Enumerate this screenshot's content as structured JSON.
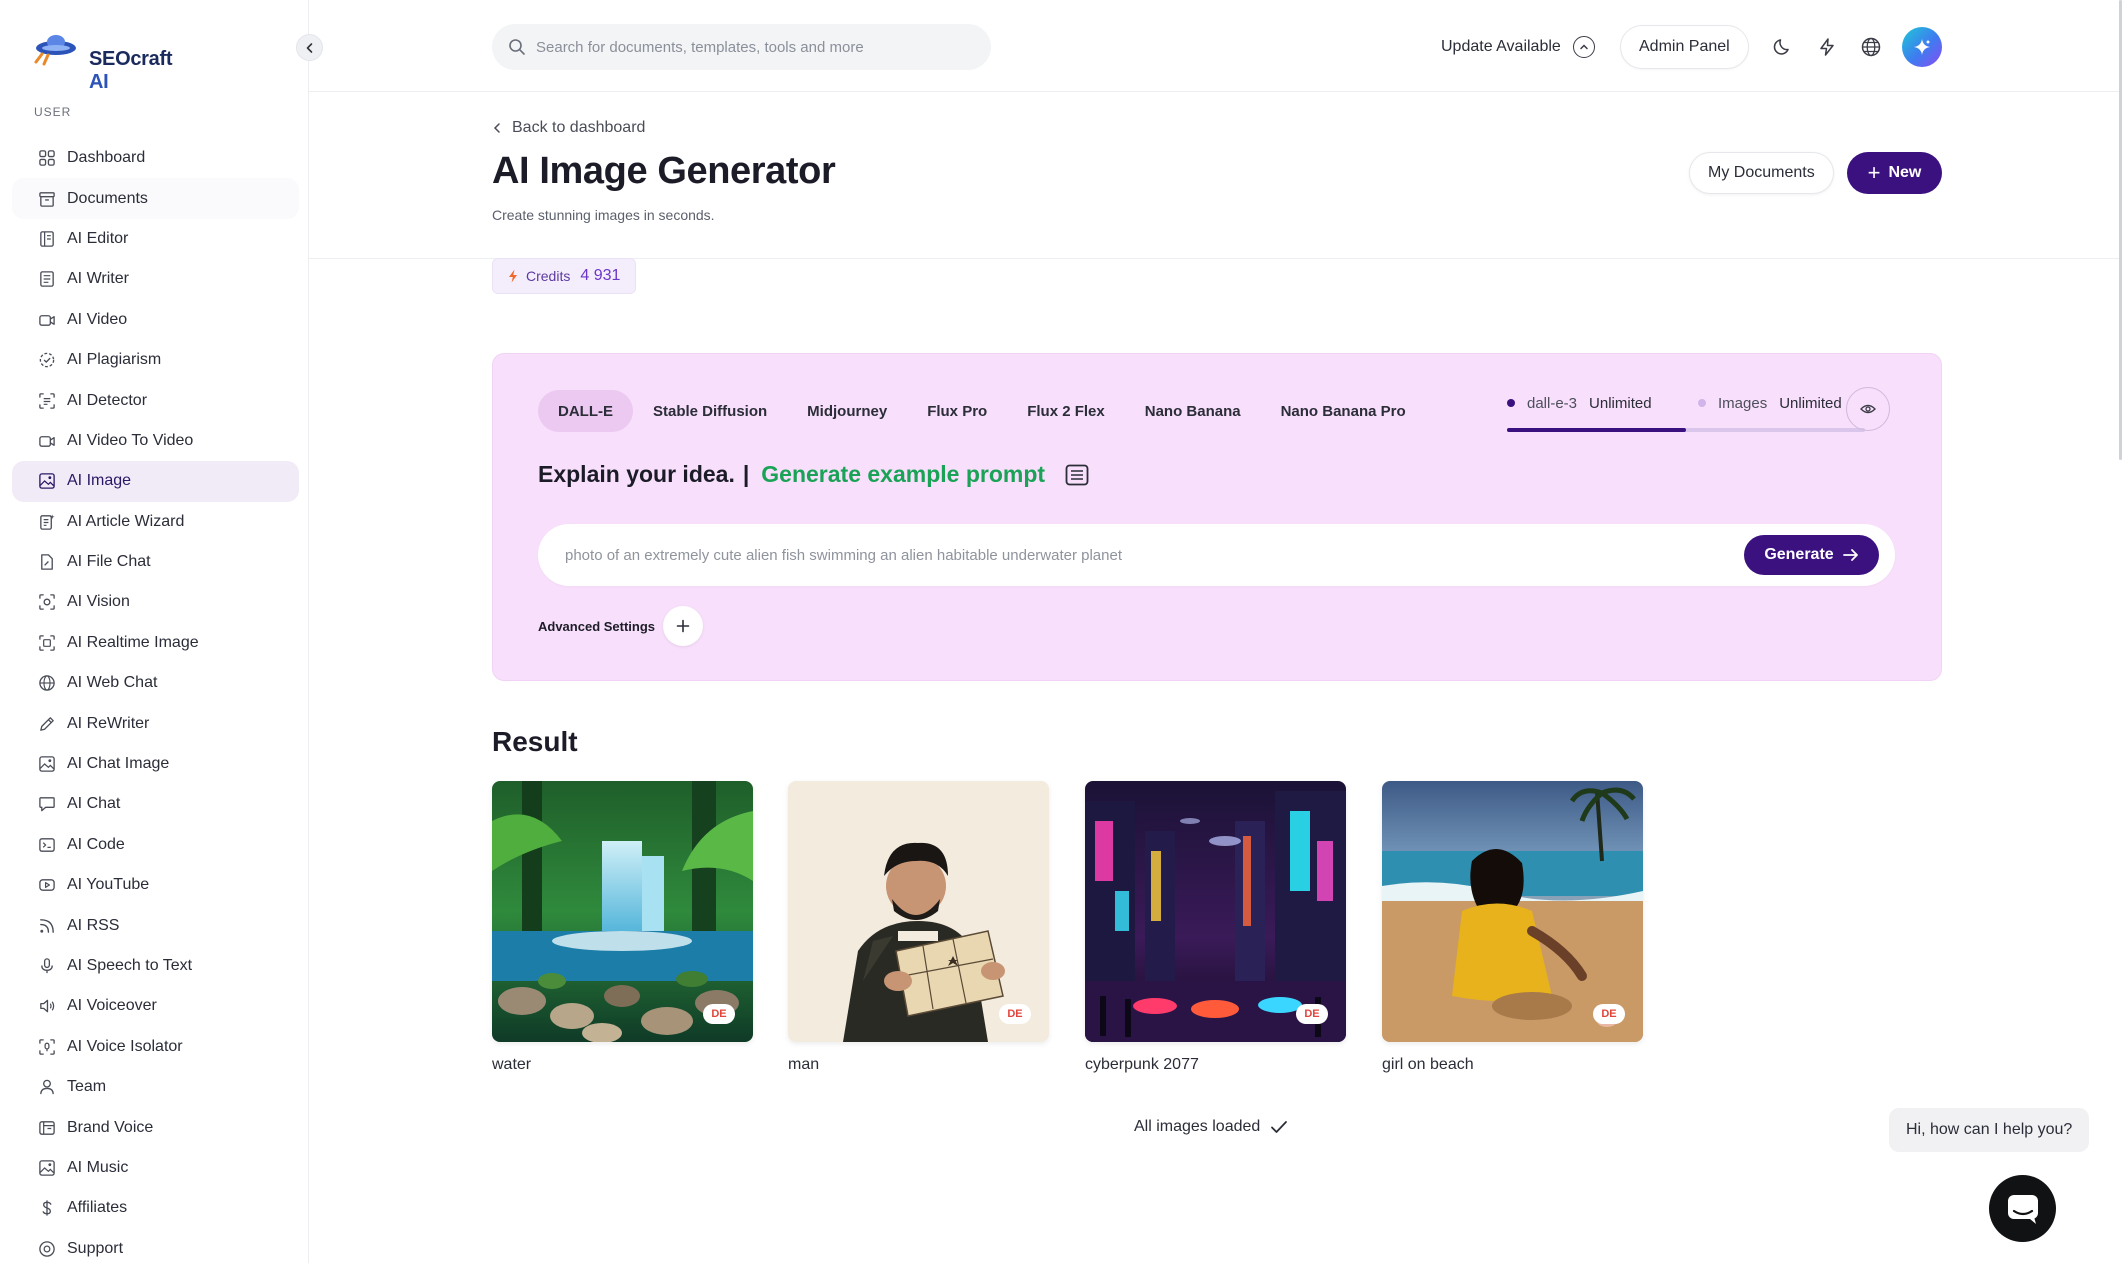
{
  "brand": {
    "name_part1": "SEOcraft",
    "name_part2": " AI"
  },
  "sidebar": {
    "section_label": "USER",
    "items": [
      {
        "label": "Dashboard",
        "icon": "grid-icon"
      },
      {
        "label": "Documents",
        "icon": "archive-icon"
      },
      {
        "label": "AI Editor",
        "icon": "editor-icon"
      },
      {
        "label": "AI Writer",
        "icon": "document-icon"
      },
      {
        "label": "AI Video",
        "icon": "video-icon"
      },
      {
        "label": "AI Plagiarism",
        "icon": "dashed-check-icon"
      },
      {
        "label": "AI Detector",
        "icon": "scan-icon"
      },
      {
        "label": "AI Video To Video",
        "icon": "video-icon"
      },
      {
        "label": "AI Image",
        "icon": "image-icon"
      },
      {
        "label": "AI Article Wizard",
        "icon": "wizard-icon"
      },
      {
        "label": "AI File Chat",
        "icon": "file-chat-icon"
      },
      {
        "label": "AI Vision",
        "icon": "vision-icon"
      },
      {
        "label": "AI Realtime Image",
        "icon": "realtime-image-icon"
      },
      {
        "label": "AI Web Chat",
        "icon": "globe-icon"
      },
      {
        "label": "AI ReWriter",
        "icon": "pen-icon"
      },
      {
        "label": "AI Chat Image",
        "icon": "image-icon"
      },
      {
        "label": "AI Chat",
        "icon": "chat-icon"
      },
      {
        "label": "AI Code",
        "icon": "terminal-icon"
      },
      {
        "label": "AI YouTube",
        "icon": "youtube-icon"
      },
      {
        "label": "AI RSS",
        "icon": "rss-icon"
      },
      {
        "label": "AI Speech to Text",
        "icon": "microphone-icon"
      },
      {
        "label": "AI Voiceover",
        "icon": "speaker-icon"
      },
      {
        "label": "AI Voice Isolator",
        "icon": "voice-isolator-icon"
      },
      {
        "label": "Team",
        "icon": "user-icon"
      },
      {
        "label": "Brand Voice",
        "icon": "brand-icon"
      },
      {
        "label": "AI Music",
        "icon": "image-icon"
      },
      {
        "label": "Affiliates",
        "icon": "dollar-icon"
      },
      {
        "label": "Support",
        "icon": "support-icon"
      }
    ],
    "active_index": 8
  },
  "topbar": {
    "search_placeholder": "Search for documents, templates, tools and more",
    "update_label": "Update Available",
    "admin_label": "Admin Panel"
  },
  "header": {
    "back_label": "Back to dashboard",
    "title": "AI Image Generator",
    "subtitle": "Create stunning images in seconds.",
    "my_documents_label": "My Documents",
    "new_label": "New"
  },
  "credits": {
    "label": "Credits",
    "value": "4 931"
  },
  "generator": {
    "tabs": [
      "DALL-E",
      "Stable Diffusion",
      "Midjourney",
      "Flux Pro",
      "Flux 2 Flex",
      "Nano Banana",
      "Nano Banana Pro"
    ],
    "active_tab": 0,
    "usage": [
      {
        "label": "dall-e-3",
        "value": "Unlimited",
        "dot_color": "#3b1180",
        "fill": 0.5
      },
      {
        "label": "Images",
        "value": "Unlimited",
        "dot_color": "#d1b4ea",
        "fill": 0.0
      }
    ],
    "explain_label": "Explain your idea.",
    "separator": "|",
    "example_label": "Generate example prompt",
    "prompt_placeholder": "photo of an extremely cute alien fish swimming an alien habitable underwater planet",
    "generate_label": "Generate",
    "advanced_label": "Advanced Settings"
  },
  "results": {
    "heading": "Result",
    "items": [
      {
        "caption": "water",
        "badge": "DE"
      },
      {
        "caption": "man",
        "badge": "DE"
      },
      {
        "caption": "cyberpunk 2077",
        "badge": "DE"
      },
      {
        "caption": "girl on beach",
        "badge": "DE"
      }
    ],
    "status": "All images loaded"
  },
  "chat": {
    "greeting": "Hi, how can I help you?"
  },
  "colors": {
    "accent": "#3b1180",
    "panel": "#f8dffb",
    "green": "#1aa356",
    "active_nav": "#f1eaf7"
  }
}
